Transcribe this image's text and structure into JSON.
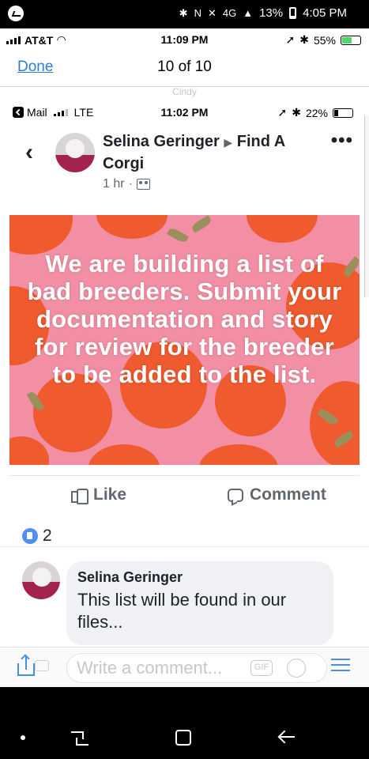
{
  "android_status": {
    "network_label": "4G",
    "battery_percent": "13%",
    "time": "4:05 PM"
  },
  "ios_status": {
    "carrier": "AT&T",
    "time": "11:09 PM",
    "battery_percent": "55%"
  },
  "viewer": {
    "done_label": "Done",
    "counter": "10 of 10",
    "ghost_label": "Cindy"
  },
  "inner_status": {
    "back_app": "Mail",
    "network": "LTE",
    "time": "11:02 PM",
    "battery_percent": "22%"
  },
  "post": {
    "author": "Selina Geringer",
    "group": "Find A Corgi",
    "age": "1 hr",
    "separator": "·",
    "image_text": "We are  building a list of bad breeders. Submit your documentation and story for review for the breeder to be added to the list.",
    "like_label": "Like",
    "comment_label": "Comment",
    "reaction_count": "2"
  },
  "comment": {
    "author": "Selina Geringer",
    "text": "This list will be found in our files..."
  },
  "composer": {
    "placeholder": "Write a comment...",
    "gif_label": "GIF"
  },
  "colors": {
    "facebook_blue": "#4f8ff6",
    "image_pink": "#f38fa4",
    "orange": "#ef5a2e",
    "ios_link": "#2f7dd5"
  },
  "icons": [
    "messenger-icon",
    "bluetooth-icon",
    "nfc-icon",
    "mute-icon",
    "signal-icon",
    "battery-icon",
    "wifi-icon",
    "location-icon",
    "back-chevron-icon",
    "more-icon",
    "group-icon",
    "like-icon",
    "comment-icon",
    "like-reaction-icon",
    "share-icon",
    "camera-icon",
    "gif-icon",
    "emoji-icon",
    "menu-icon",
    "recents-icon",
    "home-icon",
    "back-icon"
  ]
}
